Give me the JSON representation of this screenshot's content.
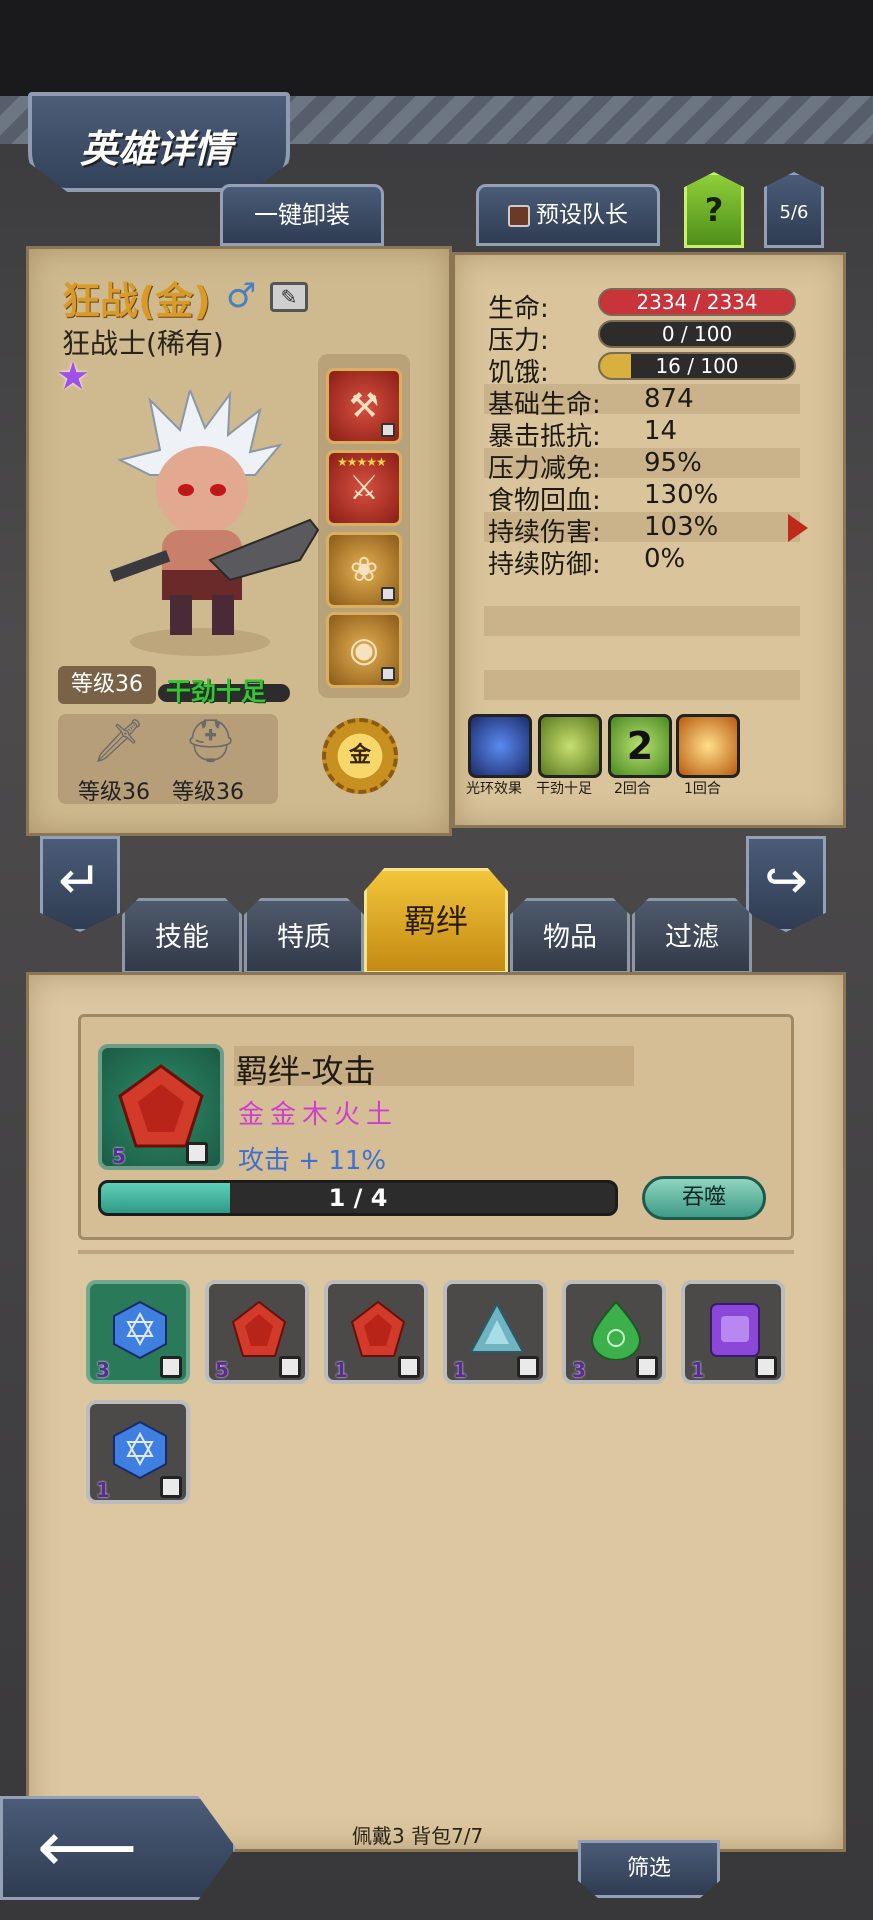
{
  "header": {
    "title": "英雄详情"
  },
  "top_buttons": {
    "unequip": "一键卸装",
    "preset_captain": "预设队长",
    "help": "?",
    "hero_index": "5/6"
  },
  "hero": {
    "name": "狂战(金)",
    "class_rarity": "狂战士(稀有)",
    "level": "等级36",
    "mood": "干劲十足",
    "weapon_level": "等级36",
    "armor_level": "等级36",
    "element_badge": "金"
  },
  "stats": {
    "hp_label": "生命:",
    "hp_value": "2334 / 2334",
    "hp_fill": 1.0,
    "stress_label": "压力:",
    "stress_value": "0 / 100",
    "stress_fill": 0,
    "hunger_label": "饥饿:",
    "hunger_value": "16 / 100",
    "hunger_fill": 0.16,
    "rows": [
      {
        "label": "基础生命:",
        "value": "874"
      },
      {
        "label": "暴击抵抗:",
        "value": "14"
      },
      {
        "label": "压力减免:",
        "value": "95%"
      },
      {
        "label": "食物回血:",
        "value": "130%"
      },
      {
        "label": "持续伤害:",
        "value": "103%"
      },
      {
        "label": "持续防御:",
        "value": "0%"
      }
    ]
  },
  "buffs": [
    {
      "name": "光环效果",
      "icon": "skull-aura-icon",
      "color": "#3a6ad8"
    },
    {
      "name": "干劲十足",
      "icon": "cheer-icon",
      "color": "#8ab038"
    },
    {
      "name": "2回合",
      "icon": "two-turn-icon",
      "color": "#78b83a",
      "overlay": "2"
    },
    {
      "name": "1回合",
      "icon": "sunburst-icon",
      "color": "#d88a20"
    }
  ],
  "tabs": [
    {
      "label": "技能"
    },
    {
      "label": "特质"
    },
    {
      "label": "羁绊",
      "active": true
    },
    {
      "label": "物品"
    },
    {
      "label": "过滤"
    }
  ],
  "bond": {
    "title": "羁绊-攻击",
    "elements": "金金木火土",
    "effect": "攻击 + 11%",
    "progress_text": "1 / 4",
    "progress_fill": 0.25,
    "devour_label": "吞噬",
    "gem_count": "5"
  },
  "gems": [
    {
      "type": "blue-hex",
      "count": "3",
      "selected": true,
      "color": "#3f7fe0"
    },
    {
      "type": "red-pentagon",
      "count": "5",
      "color": "#d23a2a"
    },
    {
      "type": "red-pentagon",
      "count": "1",
      "color": "#d23a2a"
    },
    {
      "type": "teal-triangle",
      "count": "1",
      "color": "#6fb4c0"
    },
    {
      "type": "green-drop",
      "count": "3",
      "color": "#3cb04a"
    },
    {
      "type": "purple-square",
      "count": "1",
      "color": "#8a48d8"
    },
    {
      "type": "blue-hex",
      "count": "1",
      "color": "#3f7fe0"
    }
  ],
  "footer": {
    "inventory": "佩戴3 背包7/7",
    "filter": "筛选"
  }
}
